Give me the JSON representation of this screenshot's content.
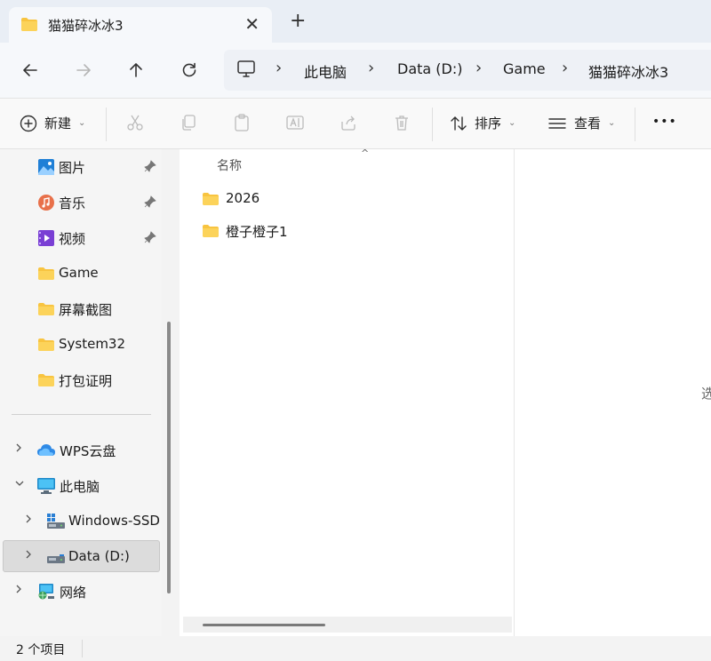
{
  "tab": {
    "title": "猫猫碎冰冰3",
    "close": "✕",
    "new_tab": "+"
  },
  "address": {
    "crumbs": [
      "此电脑",
      "Data (D:)",
      "Game",
      "猫猫碎冰冰3"
    ],
    "separator": "›"
  },
  "toolbar": {
    "new_label": "新建",
    "sort_label": "排序",
    "view_label": "查看",
    "more_label": "•••"
  },
  "sidebar": {
    "items": [
      {
        "label": "图片",
        "icon": "pictures-icon",
        "pinned": true
      },
      {
        "label": "音乐",
        "icon": "music-icon",
        "pinned": true
      },
      {
        "label": "视频",
        "icon": "video-icon",
        "pinned": true
      },
      {
        "label": "Game",
        "icon": "folder-icon",
        "pinned": false
      },
      {
        "label": "屏幕截图",
        "icon": "folder-icon",
        "pinned": false
      },
      {
        "label": "System32",
        "icon": "folder-icon",
        "pinned": false
      },
      {
        "label": "打包证明",
        "icon": "folder-icon",
        "pinned": false
      }
    ],
    "tree": [
      {
        "label": "WPS云盘",
        "icon": "cloud-icon",
        "expanded": false
      },
      {
        "label": "此电脑",
        "icon": "computer-icon",
        "expanded": true
      },
      {
        "label": "Windows-SSD",
        "icon": "ssd-drive-icon",
        "expanded": false
      },
      {
        "label": "Data (D:)",
        "icon": "hdd-drive-icon",
        "expanded": false,
        "selected": true
      },
      {
        "label": "网络",
        "icon": "network-icon",
        "expanded": false
      }
    ]
  },
  "content": {
    "column_name": "名称",
    "sort_caret": "^",
    "files": [
      {
        "name": "2026",
        "type": "folder"
      },
      {
        "name": "橙子橙子1",
        "type": "folder"
      }
    ]
  },
  "details": {
    "hint": "选"
  },
  "status": {
    "item_count": "2 个项目"
  },
  "colors": {
    "folder": "#f8c440",
    "accent": "#0067c0"
  }
}
